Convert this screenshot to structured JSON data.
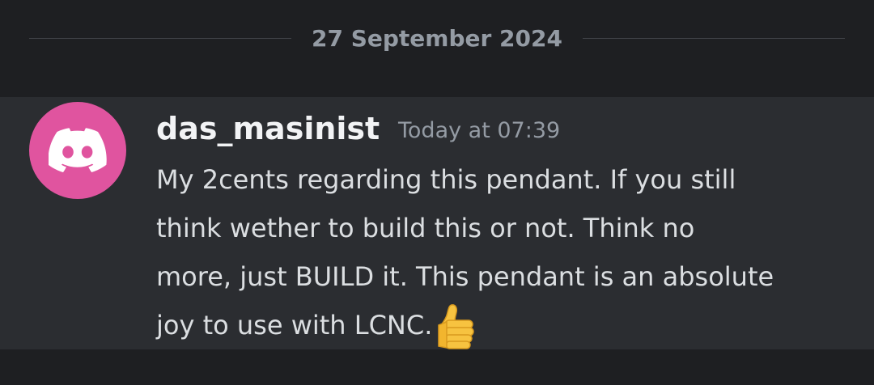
{
  "divider": {
    "date": "27 September 2024"
  },
  "message": {
    "author": "das_masinist",
    "timestamp": "Today at 07:39",
    "lines": [
      "My 2cents regarding this pendant. If you still",
      "think wether to build this or not. Think no",
      "more, just BUILD it. This pendant is an absolute",
      "joy to use with LCNC."
    ],
    "emoji": "thumbs-up",
    "avatar_icon": "discord-logo-icon"
  },
  "colors": {
    "background": "#1e1f22",
    "message_highlight": "#2b2d31",
    "avatar": "#e0549f",
    "username": "#f2f3f5",
    "timestamp": "#949ba4",
    "text": "#dbdee1"
  }
}
